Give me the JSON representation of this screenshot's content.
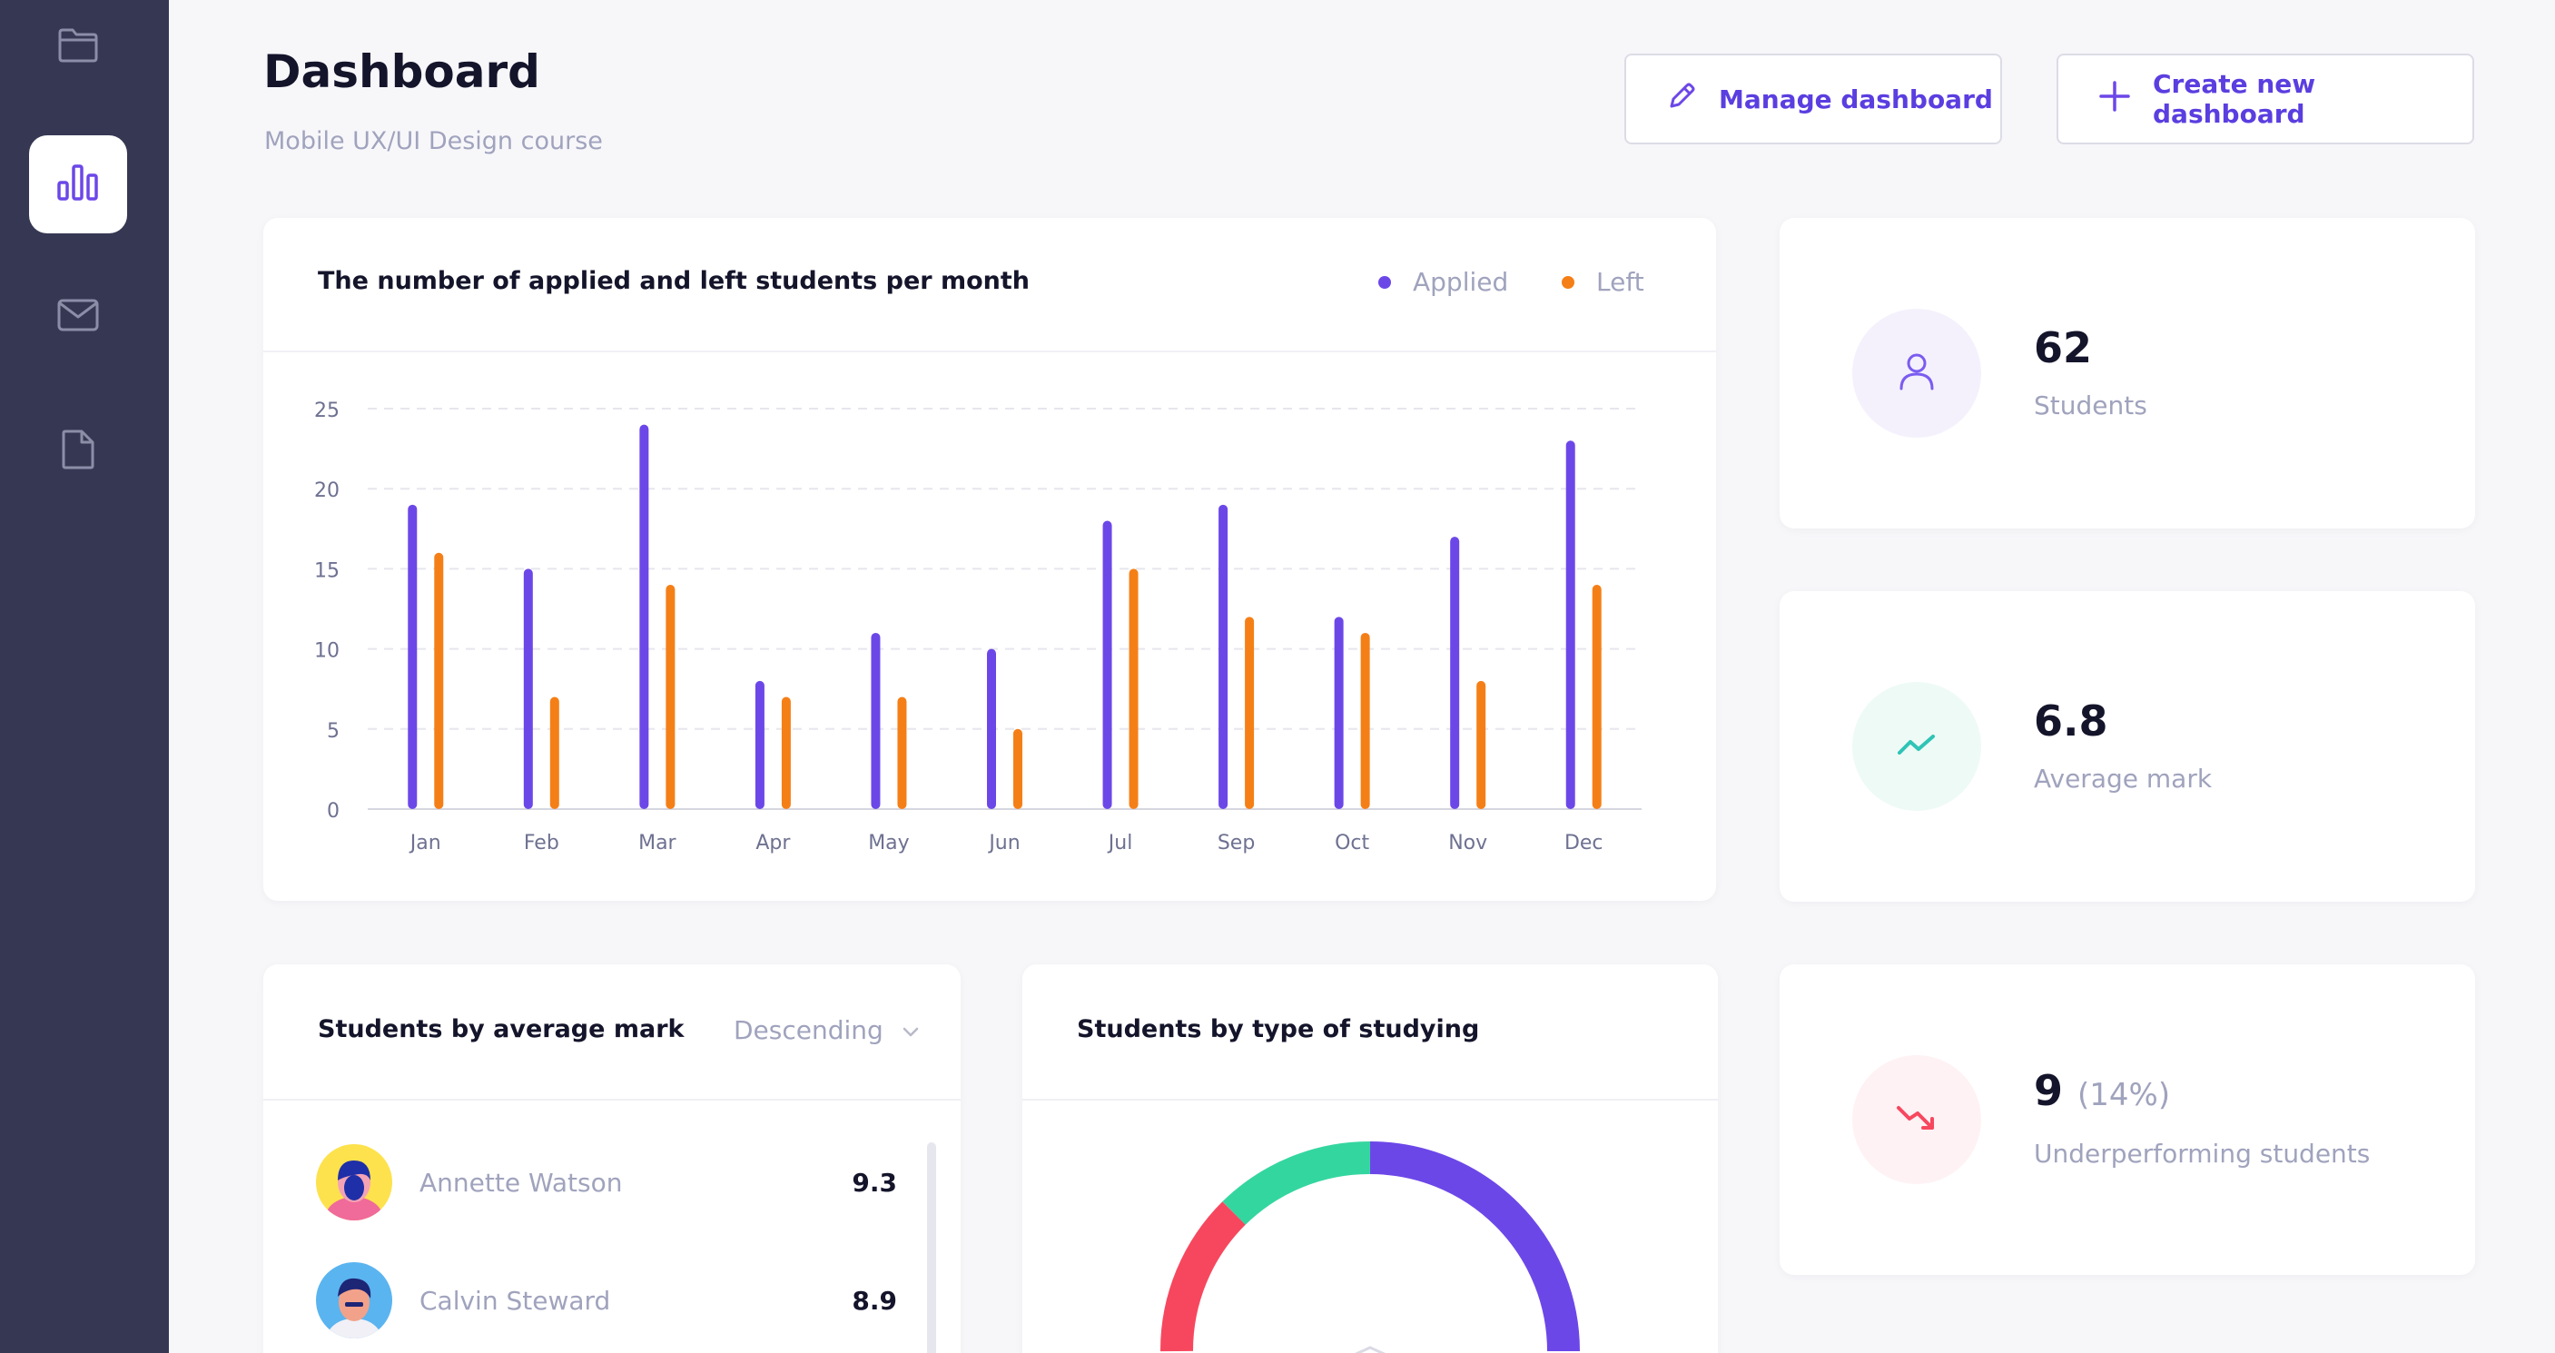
{
  "sidebar": {
    "items": [
      {
        "icon": "folder-icon"
      },
      {
        "icon": "bar-chart-icon",
        "active": true
      },
      {
        "icon": "mail-icon"
      },
      {
        "icon": "document-icon"
      }
    ]
  },
  "header": {
    "title": "Dashboard",
    "subtitle": "Mobile UX/UI Design course",
    "manage_label": "Manage dashboard",
    "create_label": "Create new dashboard"
  },
  "colors": {
    "accent": "#6c47e8",
    "applied": "#6c47e8",
    "left": "#f57f17",
    "sidebar": "#363853",
    "green": "#2ed3a2",
    "red": "#f7475e"
  },
  "chart_data": {
    "type": "bar",
    "title": "The number of applied and left students per month",
    "categories": [
      "Jan",
      "Feb",
      "Mar",
      "Apr",
      "May",
      "Jun",
      "Jul",
      "Sep",
      "Oct",
      "Nov",
      "Dec"
    ],
    "series": [
      {
        "name": "Applied",
        "values": [
          19,
          15,
          24,
          8,
          11,
          10,
          18,
          19,
          12,
          17,
          23
        ]
      },
      {
        "name": "Left",
        "values": [
          16,
          7,
          14,
          7,
          7,
          5,
          15,
          12,
          11,
          8,
          14
        ]
      }
    ],
    "yticks": [
      0,
      5,
      10,
      15,
      20,
      25
    ],
    "ylim": [
      0,
      25
    ],
    "grid": true,
    "legend": "top-right"
  },
  "stats": {
    "students": {
      "value": "62",
      "label": "Students",
      "icon": "user-icon"
    },
    "average": {
      "value": "6.8",
      "label": "Average mark",
      "icon": "trend-up-icon"
    },
    "under": {
      "value": "9",
      "pct": "(14%)",
      "label": "Underperforming students",
      "icon": "trend-down-icon"
    }
  },
  "list": {
    "title": "Students by average mark",
    "sort": "Descending",
    "rows": [
      {
        "name": "Annette Watson",
        "mark": "9.3"
      },
      {
        "name": "Calvin Steward",
        "mark": "8.9"
      }
    ]
  },
  "donut": {
    "title": "Students by type of studying"
  }
}
